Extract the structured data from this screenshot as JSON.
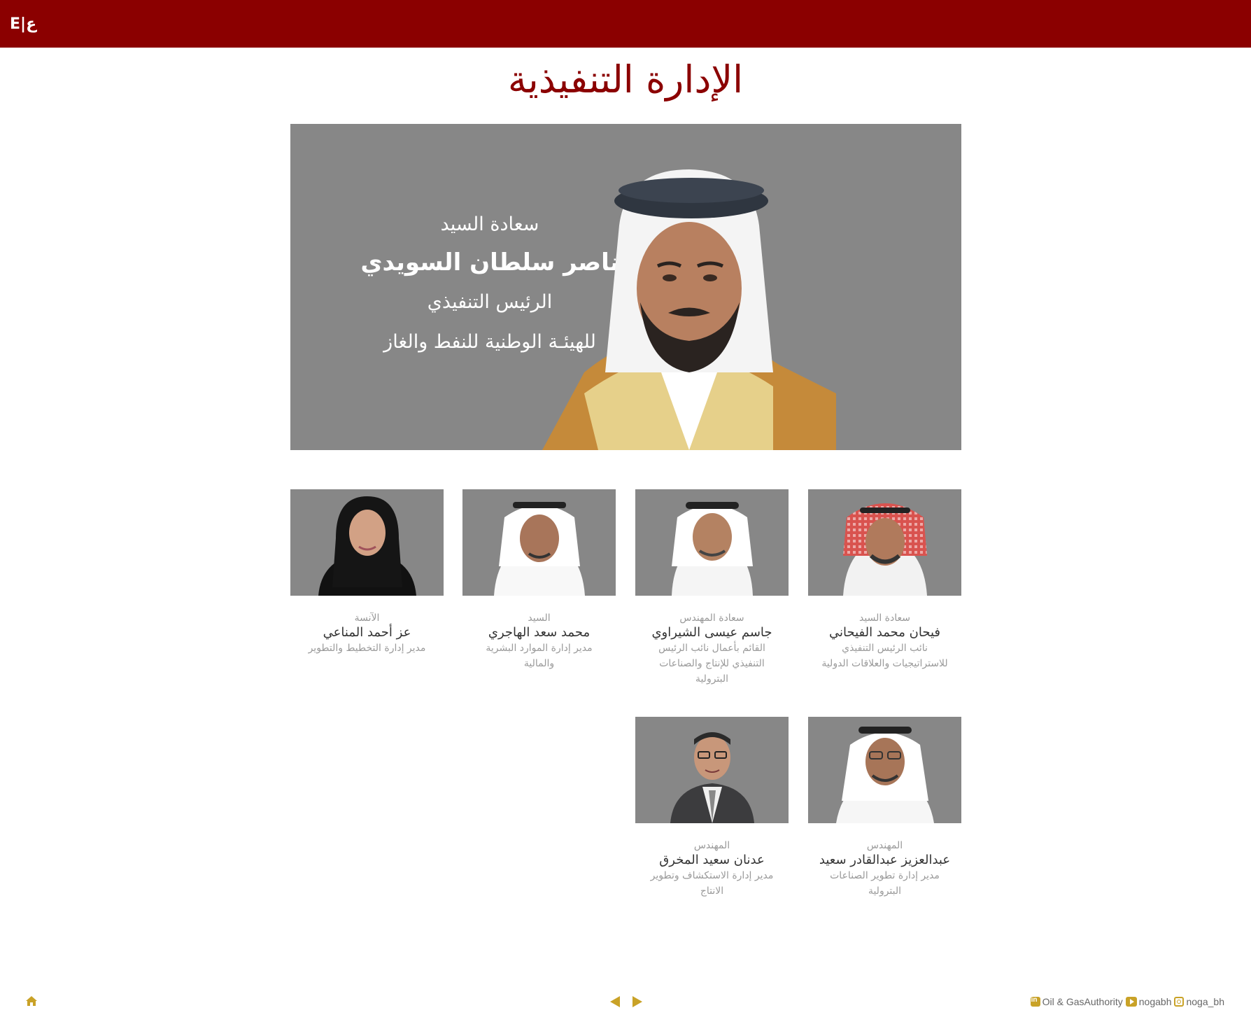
{
  "header": {
    "lang_toggle": "E|ع",
    "bar_color": "#8b0000"
  },
  "page": {
    "title": "الإدارة التنفيذية"
  },
  "hero": {
    "honorific": "سعادة السيد",
    "name": "ناصر سلطان السويدي",
    "position": "الرئيس التنفيذي",
    "organization": "للهيئـة الوطنية للنفط والغاز"
  },
  "executives": [
    {
      "honorific": "سعادة السيد",
      "name": "فيحان محمد الفيحاني",
      "role": "نائب الرئيس التنفيذي للاستراتيجيات والعلاقات الدولية"
    },
    {
      "honorific": "سعادة المهندس",
      "name": "جاسم عيسى الشيراوي",
      "role": "القائم بأعمال نائب الرئيس التنفيذي للإنتاج والصناعات البترولية"
    },
    {
      "honorific": "السيد",
      "name": "محمد سعد الهاجري",
      "role": "مدير إدارة الموارد البشرية والمالية"
    },
    {
      "honorific": "الآنسة",
      "name": "عز أحمد المناعي",
      "role": "مدير إدارة التخطيط والتطوير"
    },
    {
      "honorific": "المهندس",
      "name": "عبدالعزيز عبدالقادر سعيد",
      "role": "مدير إدارة تطوير الصناعات البترولية"
    },
    {
      "honorific": "المهندس",
      "name": "عدنان سعيد المخرق",
      "role": "مدير إدارة الاستكشاف وتطوير الانتاج"
    }
  ],
  "footer": {
    "home_icon": "home-icon",
    "prev_icon": "arrow-left-icon",
    "next_icon": "arrow-right-icon",
    "linkedin": "Oil & GasAuthority",
    "youtube": "nogabh",
    "instagram": "noga_bh",
    "accent_color": "#c9a227"
  }
}
